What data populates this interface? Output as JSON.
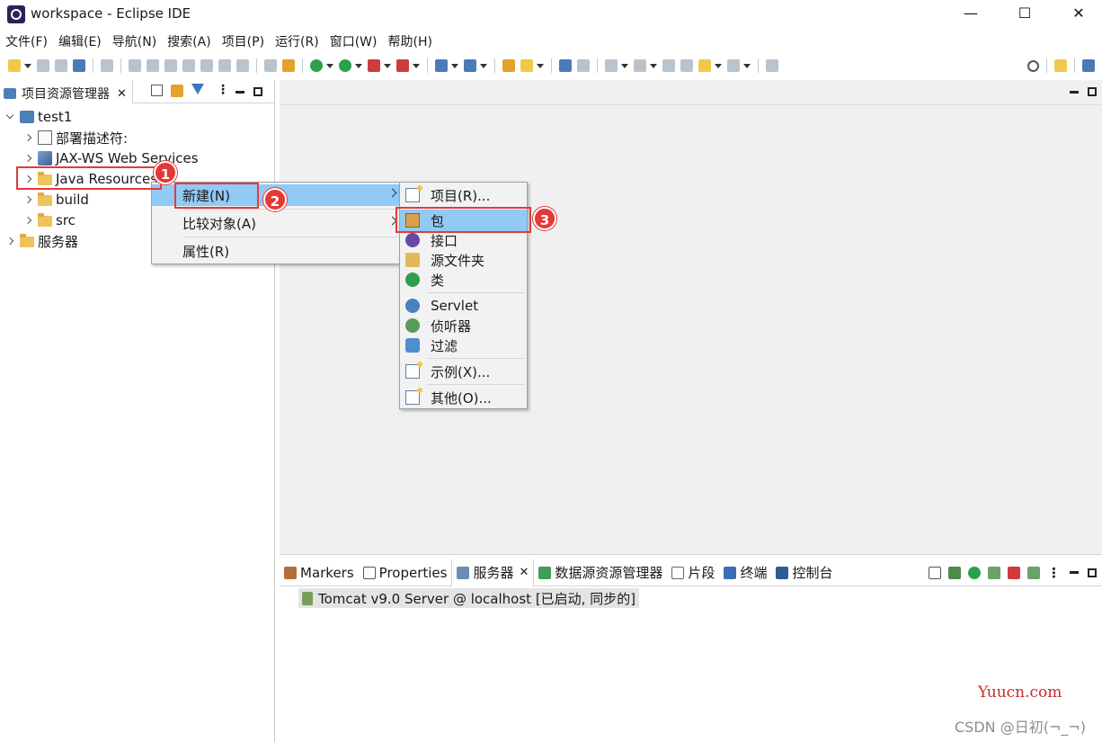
{
  "window": {
    "title": "workspace - Eclipse IDE",
    "minimize_glyph": "—",
    "maximize_glyph": "☐",
    "close_glyph": "✕"
  },
  "menubar": [
    "文件(F)",
    "编辑(E)",
    "导航(N)",
    "搜索(A)",
    "项目(P)",
    "运行(R)",
    "窗口(W)",
    "帮助(H)"
  ],
  "explorer": {
    "tab_label": "项目资源管理器",
    "tree": [
      {
        "label": "test1",
        "icon": "project-icon",
        "expanded": true
      },
      {
        "label": "部署描述符:",
        "icon": "deployment-descriptor-icon"
      },
      {
        "label": "JAX-WS Web Services",
        "icon": "web-services-icon"
      },
      {
        "label": "Java Resources",
        "icon": "java-resources-folder-icon"
      },
      {
        "label": "build",
        "icon": "folder-icon"
      },
      {
        "label": "src",
        "icon": "folder-icon"
      },
      {
        "label": "服务器",
        "icon": "folder-icon"
      }
    ]
  },
  "context_menu": {
    "items": [
      "新建(N)",
      "比较对象(A)",
      "属性(R)"
    ],
    "highlighted": "新建(N)"
  },
  "submenu": {
    "items": [
      "项目(R)...",
      "包",
      "接口",
      "源文件夹",
      "类",
      "Servlet",
      "侦听器",
      "过滤",
      "示例(X)...",
      "其他(O)..."
    ],
    "highlighted": "包"
  },
  "bottom_panel": {
    "tabs": [
      "Markers",
      "Properties",
      "服务器",
      "数据源资源管理器",
      "片段",
      "终端",
      "控制台"
    ],
    "active_tab": "服务器",
    "server_entry": "Tomcat v9.0 Server @ localhost  [已启动, 同步的]"
  },
  "annotations": {
    "badges": [
      "1",
      "2",
      "3"
    ],
    "color": "#e23b3b"
  },
  "watermarks": {
    "site": "Yuucn.com",
    "author": "CSDN @日初(¬_¬)"
  },
  "colors": {
    "menu_highlight": "#91c9f7",
    "editor_bg": "#f0f0f0",
    "annotation_red": "#e23b3b"
  }
}
